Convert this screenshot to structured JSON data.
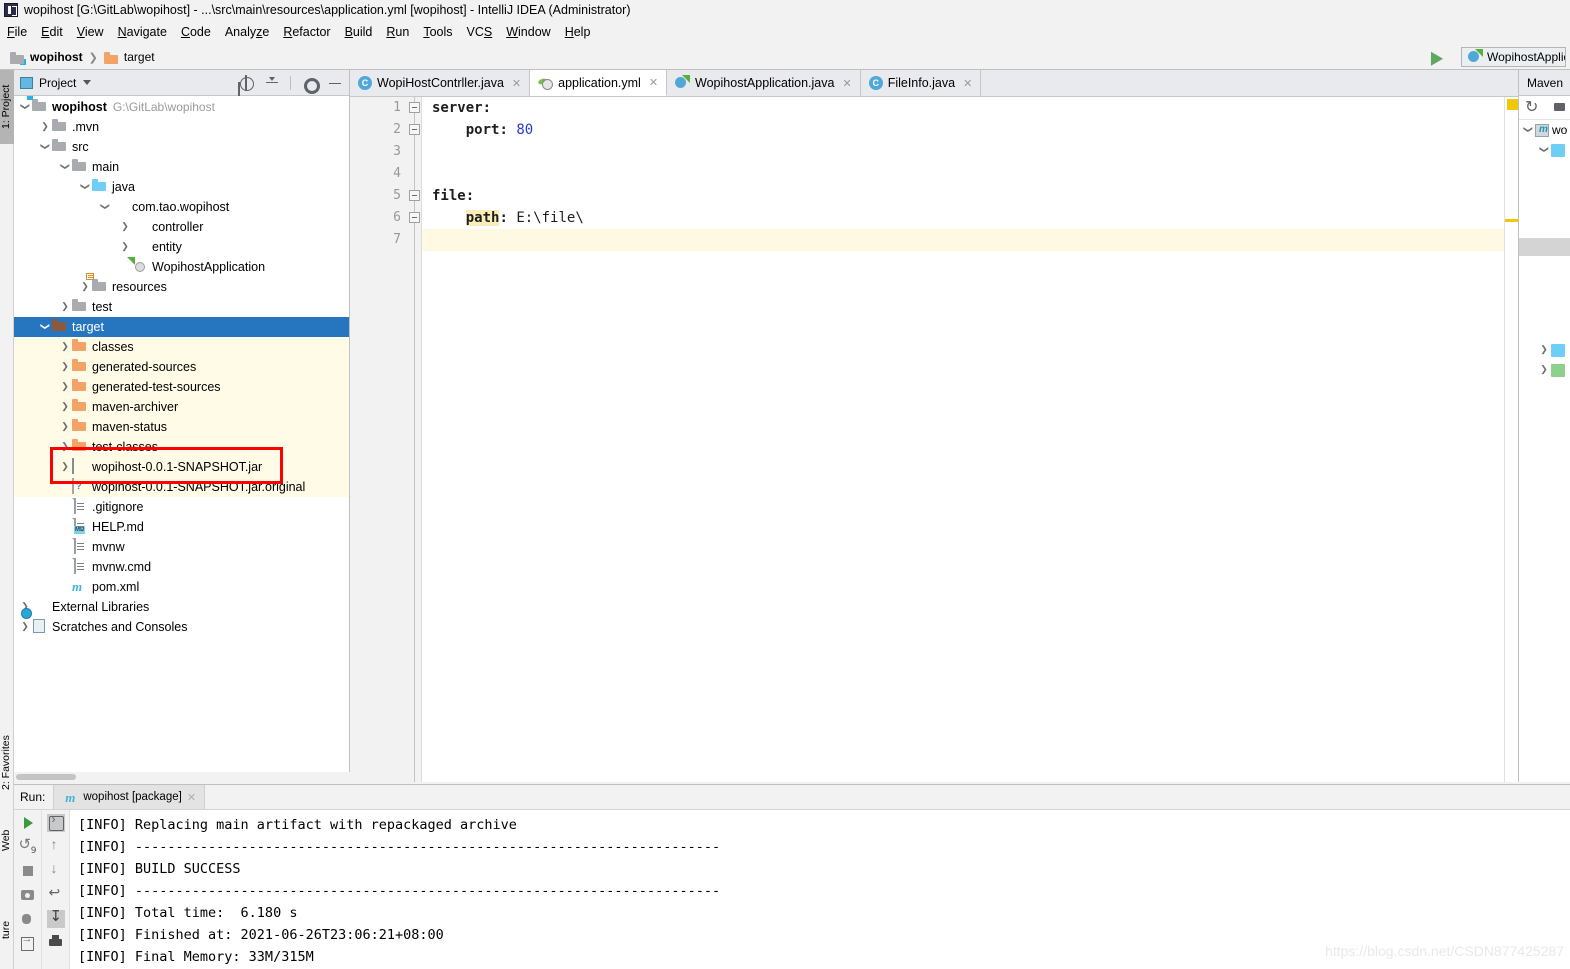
{
  "window": {
    "title": "wopihost [G:\\GitLab\\wopihost] - ...\\src\\main\\resources\\application.yml [wopihost] - IntelliJ IDEA (Administrator)",
    "app_icon": "intellij-idea-icon"
  },
  "menu": [
    {
      "label": "File",
      "mnemonic": "F"
    },
    {
      "label": "Edit",
      "mnemonic": "E"
    },
    {
      "label": "View",
      "mnemonic": "V"
    },
    {
      "label": "Navigate",
      "mnemonic": "N"
    },
    {
      "label": "Code",
      "mnemonic": "C"
    },
    {
      "label": "Analyze",
      "mnemonic": "z"
    },
    {
      "label": "Refactor",
      "mnemonic": "R"
    },
    {
      "label": "Build",
      "mnemonic": "B"
    },
    {
      "label": "Run",
      "mnemonic": "R"
    },
    {
      "label": "Tools",
      "mnemonic": "T"
    },
    {
      "label": "VCS",
      "mnemonic": "S"
    },
    {
      "label": "Window",
      "mnemonic": "W"
    },
    {
      "label": "Help",
      "mnemonic": "H"
    }
  ],
  "navbar": {
    "crumbs": [
      {
        "label": "wopihost",
        "icon": "module-icon",
        "bold": true
      },
      {
        "label": "target",
        "icon": "folder-orange-icon",
        "bold": false
      }
    ],
    "run_config": {
      "label": "WopihostApplic",
      "icon": "spring-boot-icon"
    },
    "build_icon": "build-hammer-icon"
  },
  "left_tool_strip": [
    {
      "label": "1: Project",
      "active": true
    },
    {
      "label": "2: Favorites",
      "active": false
    },
    {
      "label": "Web",
      "active": false
    },
    {
      "label": "ture",
      "active": false
    }
  ],
  "project_panel": {
    "title": "Project",
    "icon": "project-view-icon",
    "tools": [
      {
        "name": "locate-icon"
      },
      {
        "name": "collapse-all-icon"
      },
      {
        "name": "gear-icon"
      },
      {
        "name": "hide-icon"
      }
    ],
    "tree": [
      {
        "label": "wopihost",
        "note": "G:\\GitLab\\wopihost",
        "indent": 0,
        "arrow": "down",
        "icon": "module-icon",
        "bold": true,
        "state": "normal"
      },
      {
        "label": ".mvn",
        "note": "",
        "indent": 1,
        "arrow": "right",
        "icon": "folder-gray-icon",
        "bold": false,
        "state": "normal"
      },
      {
        "label": "src",
        "note": "",
        "indent": 1,
        "arrow": "down",
        "icon": "folder-gray-icon",
        "bold": false,
        "state": "normal"
      },
      {
        "label": "main",
        "note": "",
        "indent": 2,
        "arrow": "down",
        "icon": "folder-gray-icon",
        "bold": false,
        "state": "normal"
      },
      {
        "label": "java",
        "note": "",
        "indent": 3,
        "arrow": "down",
        "icon": "folder-source-icon",
        "bold": false,
        "state": "normal"
      },
      {
        "label": "com.tao.wopihost",
        "note": "",
        "indent": 4,
        "arrow": "down",
        "icon": "package-icon",
        "bold": false,
        "state": "normal"
      },
      {
        "label": "controller",
        "note": "",
        "indent": 5,
        "arrow": "right",
        "icon": "package-icon",
        "bold": false,
        "state": "normal"
      },
      {
        "label": "entity",
        "note": "",
        "indent": 5,
        "arrow": "right",
        "icon": "package-icon",
        "bold": false,
        "state": "normal"
      },
      {
        "label": "WopihostApplication",
        "note": "",
        "indent": 5,
        "arrow": "none",
        "icon": "spring-class-icon",
        "bold": false,
        "state": "normal"
      },
      {
        "label": "resources",
        "note": "",
        "indent": 3,
        "arrow": "right",
        "icon": "folder-resources-icon",
        "bold": false,
        "state": "normal"
      },
      {
        "label": "test",
        "note": "",
        "indent": 2,
        "arrow": "right",
        "icon": "folder-gray-icon",
        "bold": false,
        "state": "normal"
      },
      {
        "label": "target",
        "note": "",
        "indent": 1,
        "arrow": "down",
        "icon": "folder-excluded-icon",
        "bold": false,
        "state": "selected"
      },
      {
        "label": "classes",
        "note": "",
        "indent": 2,
        "arrow": "right",
        "icon": "folder-orange-icon",
        "bold": false,
        "state": "library"
      },
      {
        "label": "generated-sources",
        "note": "",
        "indent": 2,
        "arrow": "right",
        "icon": "folder-orange-icon",
        "bold": false,
        "state": "library"
      },
      {
        "label": "generated-test-sources",
        "note": "",
        "indent": 2,
        "arrow": "right",
        "icon": "folder-orange-icon",
        "bold": false,
        "state": "library"
      },
      {
        "label": "maven-archiver",
        "note": "",
        "indent": 2,
        "arrow": "right",
        "icon": "folder-orange-icon",
        "bold": false,
        "state": "library"
      },
      {
        "label": "maven-status",
        "note": "",
        "indent": 2,
        "arrow": "right",
        "icon": "folder-orange-icon",
        "bold": false,
        "state": "library"
      },
      {
        "label": "test-classes",
        "note": "",
        "indent": 2,
        "arrow": "right",
        "icon": "folder-orange-icon",
        "bold": false,
        "state": "library"
      },
      {
        "label": "wopihost-0.0.1-SNAPSHOT.jar",
        "note": "",
        "indent": 2,
        "arrow": "right",
        "icon": "jar-icon",
        "bold": false,
        "state": "library"
      },
      {
        "label": "wopihost-0.0.1-SNAPSHOT.jar.original",
        "note": "",
        "indent": 2,
        "arrow": "none",
        "icon": "unknown-file-icon",
        "bold": false,
        "state": "library"
      },
      {
        "label": ".gitignore",
        "note": "",
        "indent": 2,
        "arrow": "none",
        "icon": "text-file-icon",
        "bold": false,
        "state": "normal"
      },
      {
        "label": "HELP.md",
        "note": "",
        "indent": 2,
        "arrow": "none",
        "icon": "markdown-file-icon",
        "bold": false,
        "state": "normal"
      },
      {
        "label": "mvnw",
        "note": "",
        "indent": 2,
        "arrow": "none",
        "icon": "text-file-icon",
        "bold": false,
        "state": "normal"
      },
      {
        "label": "mvnw.cmd",
        "note": "",
        "indent": 2,
        "arrow": "none",
        "icon": "text-file-icon",
        "bold": false,
        "state": "normal"
      },
      {
        "label": "pom.xml",
        "note": "",
        "indent": 2,
        "arrow": "none",
        "icon": "maven-pom-icon",
        "bold": false,
        "state": "normal"
      },
      {
        "label": "External Libraries",
        "note": "",
        "indent": 0,
        "arrow": "right",
        "icon": "external-libraries-icon",
        "bold": false,
        "state": "normal"
      },
      {
        "label": "Scratches and Consoles",
        "note": "",
        "indent": 0,
        "arrow": "right",
        "icon": "scratches-icon",
        "bold": false,
        "state": "normal"
      }
    ],
    "annotation": {
      "color": "#ff0000",
      "target": "wopihost-0.0.1-SNAPSHOT.jar"
    }
  },
  "editor": {
    "tabs": [
      {
        "label": "WopiHostContrller.java",
        "icon": "java-class-icon",
        "active": false
      },
      {
        "label": "application.yml",
        "icon": "spring-yaml-icon",
        "active": true
      },
      {
        "label": "WopihostApplication.java",
        "icon": "spring-class-icon",
        "active": false
      },
      {
        "label": "FileInfo.java",
        "icon": "java-class-icon",
        "active": false
      }
    ],
    "line_numbers": [
      "1",
      "2",
      "3",
      "4",
      "5",
      "6",
      "7"
    ],
    "current_line": 7,
    "lines": [
      {
        "n": 1,
        "indent": 0,
        "key": "server",
        "sep": ":",
        "value": "",
        "value_type": "none",
        "fold": "start"
      },
      {
        "n": 2,
        "indent": 2,
        "key": "port",
        "sep": ":",
        "value": "80",
        "value_type": "number",
        "fold": "end"
      },
      {
        "n": 3,
        "indent": 0,
        "key": "",
        "sep": "",
        "value": "",
        "value_type": "none",
        "fold": "none"
      },
      {
        "n": 4,
        "indent": 0,
        "key": "",
        "sep": "",
        "value": "",
        "value_type": "none",
        "fold": "none"
      },
      {
        "n": 5,
        "indent": 0,
        "key": "file",
        "sep": ":",
        "value": "",
        "value_type": "none",
        "fold": "start"
      },
      {
        "n": 6,
        "indent": 2,
        "key": "path",
        "sep": ":",
        "value": "E:\\file\\",
        "value_type": "string",
        "fold": "end",
        "highlight_key": true
      },
      {
        "n": 7,
        "indent": 0,
        "key": "",
        "sep": "",
        "value": "",
        "value_type": "none",
        "fold": "none"
      }
    ],
    "markers": {
      "warning_color": "#f0c808"
    }
  },
  "maven_panel": {
    "title": "Maven",
    "tools": [
      {
        "name": "refresh-icon"
      },
      {
        "name": "add-maven-project-icon"
      }
    ],
    "tree": [
      {
        "label": "wo",
        "indent": 0,
        "arrow": "down",
        "icon": "maven-project-icon"
      },
      {
        "label": "",
        "indent": 1,
        "arrow": "down",
        "icon": "maven-folder-icon"
      },
      {
        "label": "",
        "indent": 1,
        "arrow": "right",
        "icon": "maven-folder-icon"
      },
      {
        "label": "",
        "indent": 1,
        "arrow": "right",
        "icon": "maven-folder-green-icon"
      }
    ]
  },
  "run_panel": {
    "label": "Run:",
    "tab": {
      "label": "wopihost [package]",
      "icon": "maven-run-icon"
    },
    "toolbar_left": [
      {
        "name": "rerun-icon"
      },
      {
        "name": "rerun-failed-icon"
      },
      {
        "name": "stop-icon"
      },
      {
        "name": "screenshot-icon"
      },
      {
        "name": "debug-icon"
      },
      {
        "name": "exit-icon"
      }
    ],
    "toolbar_right": [
      {
        "name": "console-icon",
        "active": true
      },
      {
        "name": "scroll-up-icon",
        "active": false
      },
      {
        "name": "scroll-down-icon",
        "active": false
      },
      {
        "name": "soft-wrap-icon",
        "active": false
      },
      {
        "name": "scroll-to-end-icon",
        "active": true
      },
      {
        "name": "print-icon",
        "active": false
      }
    ],
    "console_lines": [
      "[INFO] Replacing main artifact with repackaged archive",
      "[INFO] ------------------------------------------------------------------------",
      "[INFO] BUILD SUCCESS",
      "[INFO] ------------------------------------------------------------------------",
      "[INFO] Total time:  6.180 s",
      "[INFO] Finished at: 2021-06-26T23:06:21+08:00",
      "[INFO] Final Memory: 33M/315M"
    ]
  },
  "watermark": "https://blog.csdn.net/CSDN877425287"
}
